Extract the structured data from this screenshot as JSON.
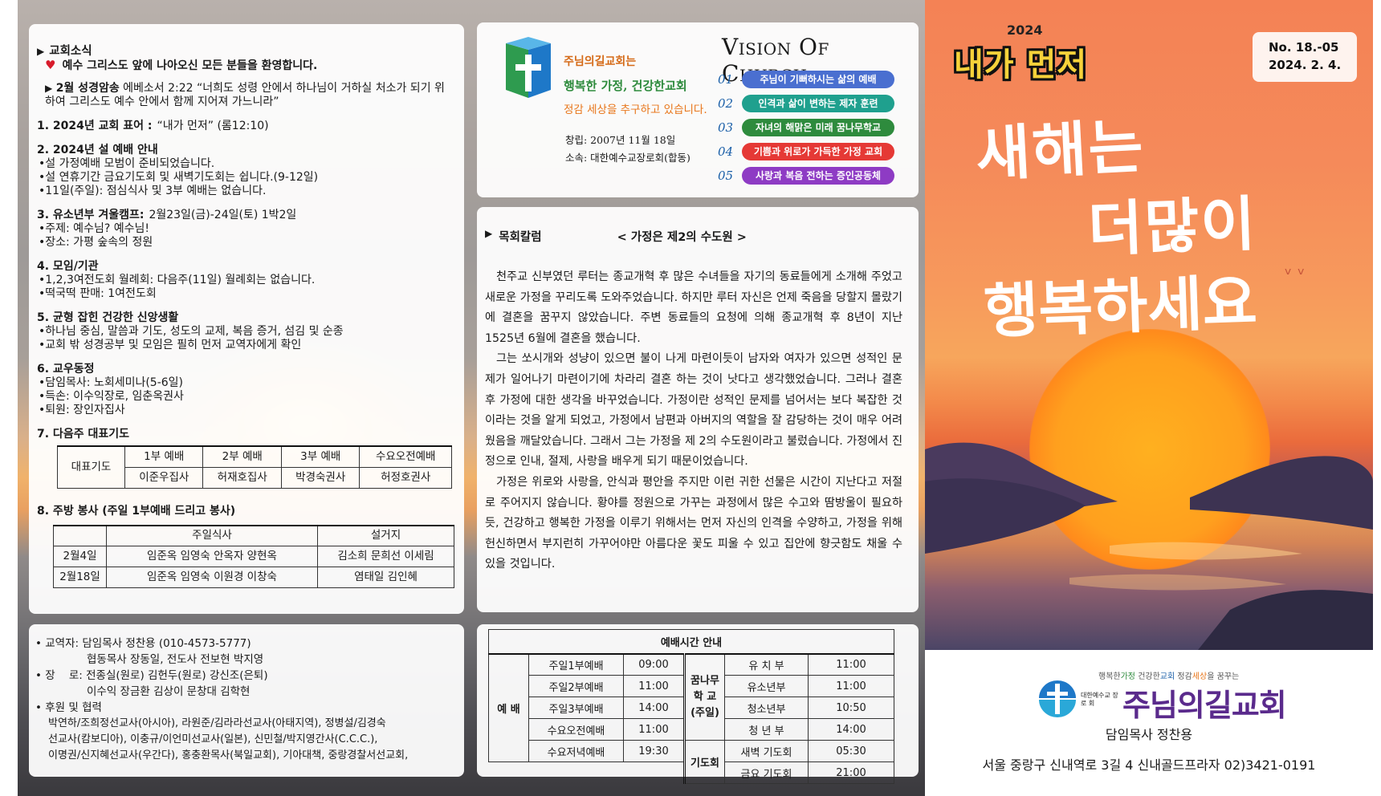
{
  "news": {
    "heading": "교회소식",
    "welcome": "예수 그리스도 앞에 나아오신 모든 분들을 환영합니다.",
    "verse_label": "2월 성경암송",
    "verse_text": "에베소서 2:22 “너희도 성령 안에서 하나님이 거하실 처소가 되기 위하여 그리스도 예수 안에서 함께 지어져 가느니라”",
    "items": [
      {
        "title": "1. 2024년 교회 표어 :",
        "title_extra": "“내가 먼저” (롬12:10)",
        "lines": []
      },
      {
        "title": "2. 2024년 설 예배 안내",
        "title_extra": "",
        "lines": [
          "•설 가정예배 모범이 준비되었습니다.",
          "•설 연휴기간 금요기도회 및 새벽기도회는 쉽니다.(9-12일)",
          "•11일(주일): 점심식사 및 3부 예배는 없습니다."
        ]
      },
      {
        "title": "3. 유소년부 겨울캠프:",
        "title_extra": "2월23일(금)-24일(토) 1박2일",
        "lines": [
          "•주제: 예수님? 예수님!",
          "•장소: 가평 숲속의 정원"
        ]
      },
      {
        "title": "4. 모임/기관",
        "title_extra": "",
        "lines": [
          "•1,2,3여전도회 월례회: 다음주(11일) 월례회는 없습니다.",
          "•떡국떡 판매: 1여전도회"
        ]
      },
      {
        "title": "5. 균형 잡힌 건강한 신앙생활",
        "title_extra": "",
        "lines": [
          "•하나님 중심, 말씀과 기도, 성도의 교제, 복음 증거, 섬김 및 순종",
          "•교회 밖 성경공부 및 모임은 필히 먼저 교역자에게 확인"
        ]
      },
      {
        "title": "6. 교우동정",
        "title_extra": "",
        "lines": [
          "•담임목사: 노회세미나(5-6일)",
          "•득손: 이수익장로, 임춘옥권사",
          "•퇴원: 장인자집사"
        ]
      },
      {
        "title": "7. 다음주 대표기도",
        "title_extra": "",
        "lines": []
      }
    ],
    "prayer": {
      "row_label": "대표기도",
      "headers": [
        "1부 예배",
        "2부 예배",
        "3부 예배",
        "수요오전예배"
      ],
      "names": [
        "이준우집사",
        "허재호집사",
        "박경숙권사",
        "허정호권사"
      ]
    },
    "kitchen_title": "8. 주방 봉사 (주일 1부예배 드리고 봉사)",
    "kitchen": {
      "headers": [
        "주일식사",
        "설거지"
      ],
      "rows": [
        {
          "date": "2월4일",
          "meal": "임준옥 임영숙 안옥자 양현옥",
          "dish": "김소희 문희선 이세림"
        },
        {
          "date": "2월18일",
          "meal": "임준옥 임영숙 이원경 이창숙",
          "dish": "염태일 김인혜"
        }
      ]
    }
  },
  "vision": {
    "slogan1": "주님의길교회는",
    "slogan2": "행복한 가정, 건강한교회",
    "slogan3": "정감 세상을 추구하고 있습니다.",
    "founded": "창립: 2007년 11월 18일",
    "affiliation": "소속: 대한예수교장로회(합동)",
    "title_big1": "V",
    "title_small1": "ISION",
    "title_big2": "O",
    "title_small2": "F",
    "title_big3": "C",
    "title_small3": "HURCH",
    "items": [
      {
        "num": "01",
        "text": "주님이 기뻐하시는 삶의 예배",
        "color": "#4a6fd0"
      },
      {
        "num": "02",
        "text": "인격과 삶이 변하는 제자 훈련",
        "color": "#1fa08e"
      },
      {
        "num": "03",
        "text": "자녀의 해맑은 미래 꿈나무학교",
        "color": "#2e8b3d"
      },
      {
        "num": "04",
        "text": "기쁨과 위로가 가득한 가정 교회",
        "color": "#e53935"
      },
      {
        "num": "05",
        "text": "사랑과 복음 전하는 증인공동체",
        "color": "#8e3bc4"
      }
    ]
  },
  "column": {
    "heading": "목회칼럼",
    "title": "< 가정은 제2의 수도원 >",
    "paragraphs": [
      "천주교 신부였던 루터는 종교개혁 후 많은 수녀들을 자기의 동료들에게 소개해 주었고 새로운 가정을 꾸리도록 도와주었습니다. 하지만 루터 자신은 언제 죽음을 당할지 몰랐기에 결혼을 꿈꾸지 않았습니다. 주변 동료들의 요청에 의해 종교개혁 후 8년이 지난 1525년 6월에 결혼을 했습니다.",
      "그는 쏘시개와 성냥이 있으면 불이 나게 마련이듯이 남자와 여자가 있으면 성적인 문제가 일어나기 마련이기에 차라리 결혼 하는 것이 낫다고 생각했었습니다. 그러나 결혼 후 가정에 대한 생각을 바꾸었습니다. 가정이란 성적인 문제를 넘어서는 보다 복잡한 것이라는 것을 알게 되었고, 가정에서 남편과 아버지의 역할을 잘 감당하는 것이 매우 어려웠음을 깨달았습니다. 그래서 그는 가정을 제 2의 수도원이라고 불렀습니다. 가정에서 진정으로 인내, 절제, 사랑을 배우게 되기 때문이었습니다.",
      "가정은 위로와 사랑을, 안식과 평안을 주지만 이런 귀한 선물은 시간이 지난다고 저절로 주어지지 않습니다. 황야를 정원으로 가꾸는 과정에서 많은 수고와 땀방울이 필요하듯, 건강하고 행복한 가정을 이루기 위해서는 먼저 자신의 인격을 수양하고, 가정을 위해 헌신하면서 부지런히 가꾸어야만 아름다운 꽃도 피울 수 있고 집안에 향긋함도 채울 수 있을 것입니다."
    ]
  },
  "staff": {
    "clergy_label": "• 교역자: ",
    "clergy_1": "담임목사 정찬용 (010-4573-5777)",
    "clergy_2": "협동목사 장동일, 전도사 전보현 박지영",
    "elders_label": "• 장    로: ",
    "elders_1": "전종실(원로) 김헌두(원로) 강신조(은퇴)",
    "elders_2": "이수익 장금환 김상이 문창대 김학현",
    "support_label": "• 후원 및 협력",
    "support_lines": [
      "박연하/조희정선교사(아시아), 라원준/김라라선교사(아태지역), 정병설/김경숙",
      "선교사(캄보디아), 이충규/이언미선교사(일본), 신민철/박지영간사(C.C.C.),",
      "이명권/신지혜선교사(우간다), 홍충환목사(북일교회), 기아대책, 중랑경찰서선교회,"
    ]
  },
  "times": {
    "title": "예배시간 안내",
    "group_worship": "예 배",
    "worship": [
      {
        "name": "주일1부예배",
        "time": "09:00"
      },
      {
        "name": "주일2부예배",
        "time": "11:00"
      },
      {
        "name": "주일3부예배",
        "time": "14:00"
      },
      {
        "name": "수요오전예배",
        "time": "11:00"
      },
      {
        "name": "수요저녁예배",
        "time": "19:30"
      }
    ],
    "group_school_1": "꿈나무",
    "group_school_2": "학  교",
    "group_school_3": "(주일)",
    "school": [
      {
        "name": "유 치 부",
        "time": "11:00"
      },
      {
        "name": "유소년부",
        "time": "11:00"
      },
      {
        "name": "청소년부",
        "time": "10:50"
      },
      {
        "name": "청 년 부",
        "time": "14:00"
      }
    ],
    "group_prayer": "기도회",
    "prayer": [
      {
        "name": "새벽 기도회",
        "time": "05:30"
      },
      {
        "name": "금요 기도회",
        "time": "21:00"
      }
    ]
  },
  "cover": {
    "badge_year": "2024",
    "badge_word": "내가 먼저",
    "issue_no": "No. 18.-05",
    "issue_date": "2024. 2. 4.",
    "greet1": "새해는",
    "greet2": "더많이",
    "greet3": "행복하세요",
    "tag_a": "행복한",
    "tag_b": "가정",
    "tag_c": " 건강한",
    "tag_d": "교회",
    "tag_e": " 정감",
    "tag_f": "세상",
    "tag_g": "을 꿈꾸는",
    "denom": "대한예수교 장 로 회",
    "church_name": "주님의길교회",
    "pastor": "담임목사 정찬용",
    "address": "서울 중랑구 신내역로 3길 4 신내골드프라자 02)3421-0191"
  }
}
